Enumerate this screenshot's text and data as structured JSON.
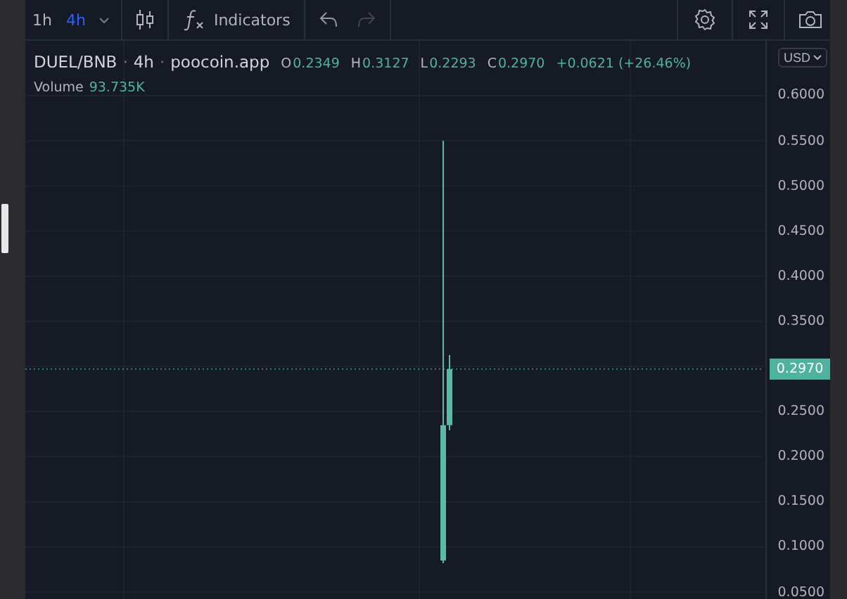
{
  "toolbar": {
    "intervals": [
      {
        "label": "1h",
        "selected": false
      },
      {
        "label": "4h",
        "selected": true
      }
    ],
    "indicators_label": "Indicators"
  },
  "legend": {
    "symbol": "DUEL/BNB",
    "separator": "·",
    "interval": "4h",
    "source": "poocoin.app",
    "ohlc": [
      {
        "label": "O",
        "value": "0.2349"
      },
      {
        "label": "H",
        "value": "0.3127"
      },
      {
        "label": "L",
        "value": "0.2293"
      },
      {
        "label": "C",
        "value": "0.2970"
      }
    ],
    "change": "+0.0621 (+26.46%)",
    "volume_label": "Volume",
    "volume_value": "93.735K"
  },
  "price_axis": {
    "currency": "USD",
    "labels": [
      {
        "kind": "tick",
        "text": "0.6000"
      },
      {
        "kind": "tick",
        "text": "0.5500"
      },
      {
        "kind": "tick",
        "text": "0.5000"
      },
      {
        "kind": "tick",
        "text": "0.4500"
      },
      {
        "kind": "tick",
        "text": "0.4000"
      },
      {
        "kind": "tick",
        "text": "0.3500"
      },
      {
        "kind": "last_price",
        "text": "0.2970"
      },
      {
        "kind": "tick",
        "text": "0.2500"
      },
      {
        "kind": "tick",
        "text": "0.2000"
      },
      {
        "kind": "tick",
        "text": "0.1500"
      },
      {
        "kind": "tick",
        "text": "0.1000"
      },
      {
        "kind": "tick",
        "text": "0.0500"
      }
    ]
  }
}
